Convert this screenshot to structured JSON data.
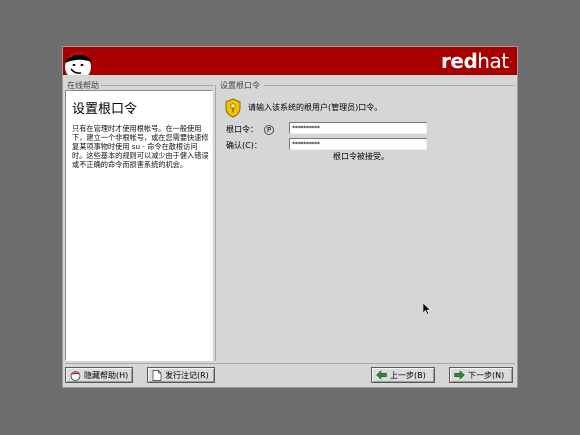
{
  "banner": {
    "brand_bold": "red",
    "brand_light": "hat",
    "brand_tm": "."
  },
  "help_panel": {
    "section_label": "在线帮助",
    "title": "设置根口令",
    "text": "只有在管理时才使用根帐号。在一般使用下，建立一个非根帐号，或在您需要快速修复某项事物时使用 su - 命令在散根访问时。这些基本的规则可以减少由于健入错误或不正确的命令而损害系统的机会。"
  },
  "main_panel": {
    "section_label": "设置根口令",
    "prompt": "请输入该系统的根用户(管理员)口令。",
    "root_password": {
      "label": "根口令：",
      "mnemonic": "P",
      "value": "**********"
    },
    "confirm_password": {
      "label": "确认(C)：",
      "value": "**********"
    },
    "status": "根口令被接受。"
  },
  "buttons": {
    "hide_help": "隐藏帮助(H)",
    "release_notes": "发行注记(R)",
    "back": "上一步(B)",
    "next": "下一步(N)"
  },
  "icons": {
    "banner_logo": "shadowman-icon",
    "prompt": "shield-key-icon",
    "hide_help": "shadowman-small-icon",
    "release_notes": "document-icon",
    "back": "arrow-left-icon",
    "next": "arrow-right-icon"
  },
  "colors": {
    "banner": "#a80000",
    "background": "#6e6e6e",
    "window": "#d6d6d6"
  }
}
